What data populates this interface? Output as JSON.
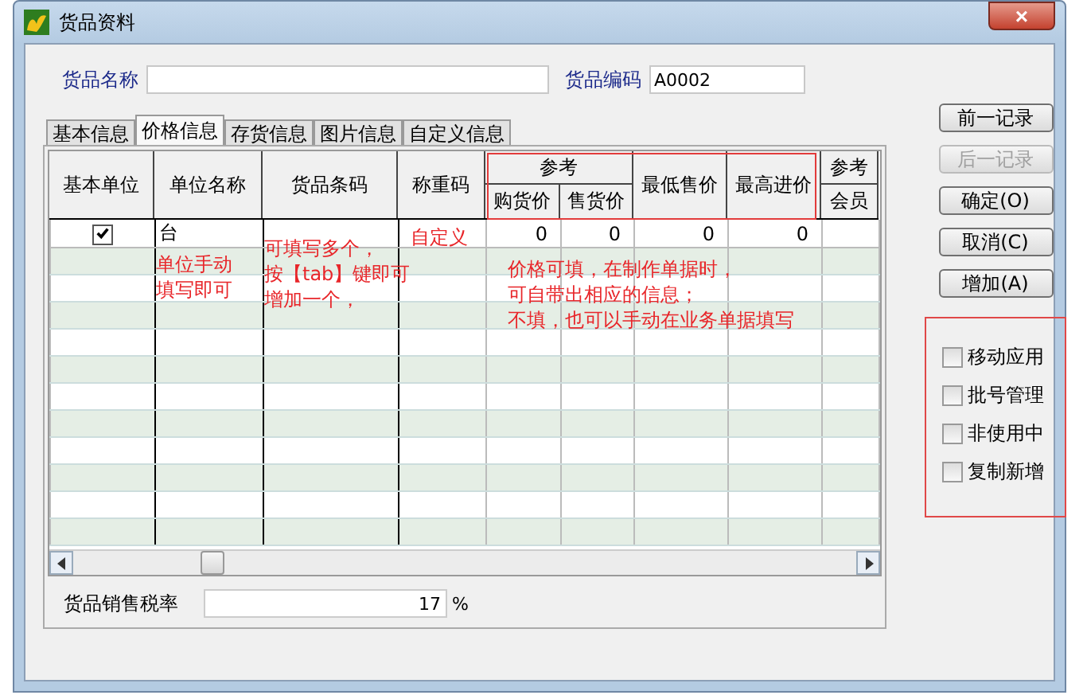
{
  "window": {
    "title": "货品资料",
    "close": "×"
  },
  "fields": [
    {
      "label": "货品名称"
    },
    {
      "label": "货品编码",
      "value": "A0002"
    }
  ],
  "tabs": [
    {
      "label": "基本信息",
      "selected": false
    },
    {
      "label": "价格信息",
      "selected": true
    },
    {
      "label": "存货信息",
      "selected": false
    },
    {
      "label": "图片信息",
      "selected": false
    },
    {
      "label": "自定义信息",
      "selected": false
    }
  ],
  "table": {
    "columns": [
      {
        "label": "基本单位"
      },
      {
        "label": "单位名称"
      },
      {
        "label": "货品条码"
      },
      {
        "label": "称重码"
      },
      {
        "group": "参考",
        "label": "购货价"
      },
      {
        "in_group": true,
        "label": "售货价"
      },
      {
        "label": "最低售价"
      },
      {
        "label": "最高进价"
      },
      {
        "group": "参考",
        "label": "会员"
      }
    ],
    "rows": [
      {
        "checked": true,
        "cells": [
          "",
          "台",
          "",
          "",
          "0",
          "0",
          "0",
          "0",
          ""
        ]
      }
    ]
  },
  "annotations": [
    {
      "lines": [
        "单位手动",
        "填写即可"
      ]
    },
    {
      "lines": [
        "可填写多个，",
        "按【tab】键即可",
        "增加一个，"
      ]
    },
    {
      "lines": [
        "自定义"
      ]
    },
    {
      "lines": [
        "价格可填，在制作单据时，",
        "可自带出相应的信息；",
        "不填，也可以手动在业务单据填写"
      ]
    }
  ],
  "tax": {
    "label": "货品销售税率",
    "value": "17",
    "unit": "%"
  },
  "buttons": [
    {
      "label": "前一记录",
      "disabled": false
    },
    {
      "label": "后一记录",
      "disabled": true
    },
    {
      "label": "确定(O)",
      "disabled": false
    },
    {
      "label": "取消(C)",
      "disabled": false
    },
    {
      "label": "增加(A)",
      "disabled": false
    }
  ],
  "options": [
    {
      "label": "移动应用",
      "checked": false
    },
    {
      "label": "批号管理",
      "checked": false
    },
    {
      "label": "非使用中",
      "checked": false
    },
    {
      "label": "复制新增",
      "checked": false
    }
  ]
}
